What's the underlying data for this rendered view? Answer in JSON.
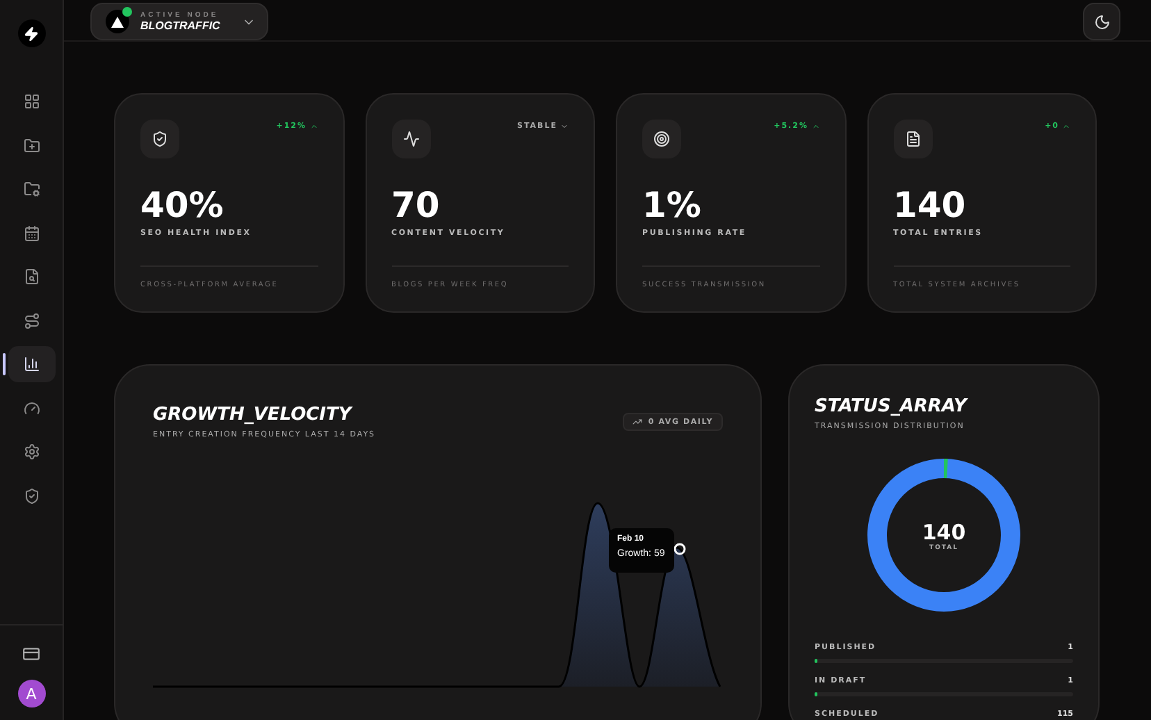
{
  "sidebar": {
    "items": [
      {
        "selected": false
      },
      {
        "selected": false
      },
      {
        "selected": false
      },
      {
        "selected": false
      },
      {
        "selected": false
      },
      {
        "selected": false
      },
      {
        "selected": true
      },
      {
        "selected": false
      },
      {
        "selected": false
      },
      {
        "selected": false
      }
    ],
    "avatar": "A"
  },
  "header": {
    "node_label": "ACTIVE NODE",
    "node_name": "BLOGTRAFFIC",
    "online": true
  },
  "stats": [
    {
      "value": "40%",
      "label": "SEO HEALTH INDEX",
      "note": "CROSS-PLATFORM AVERAGE",
      "trend": {
        "text": "+12%",
        "kind": "up"
      }
    },
    {
      "value": "70",
      "label": "CONTENT VELOCITY",
      "note": "BLOGS PER WEEK FREQ",
      "trend": {
        "text": "STABLE",
        "kind": "flat"
      }
    },
    {
      "value": "1%",
      "label": "PUBLISHING RATE",
      "note": "SUCCESS TRANSMISSION",
      "trend": {
        "text": "+5.2%",
        "kind": "up"
      }
    },
    {
      "value": "140",
      "label": "TOTAL ENTRIES",
      "note": "TOTAL SYSTEM ARCHIVES",
      "trend": {
        "text": "+0",
        "kind": "up"
      }
    }
  ],
  "growth": {
    "title": "GROWTH_VELOCITY",
    "subtitle": "ENTRY CREATION FREQUENCY LAST 14 DAYS",
    "badge": "0 AVG DAILY",
    "tooltip": {
      "date": "Feb 10",
      "value": "Growth: 59"
    }
  },
  "status": {
    "title": "STATUS_ARRAY",
    "subtitle": "TRANSMISSION DISTRIBUTION",
    "total": "140",
    "total_label": "TOTAL",
    "items": [
      {
        "label": "PUBLISHED",
        "count": "1",
        "level": 0.01
      },
      {
        "label": "IN DRAFT",
        "count": "1",
        "level": 0.01
      },
      {
        "label": "SCHEDULED",
        "count": "115"
      }
    ]
  }
}
